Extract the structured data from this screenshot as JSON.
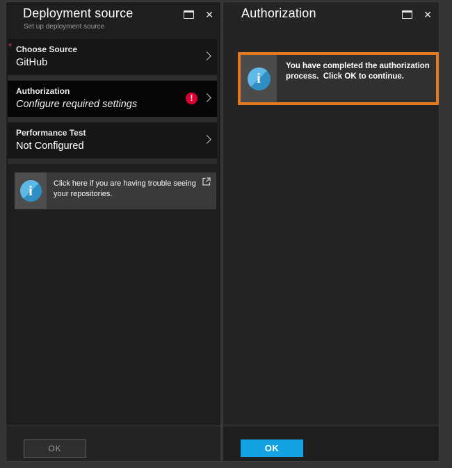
{
  "left_blade": {
    "title": "Deployment source",
    "subtitle": "Set up deployment source",
    "items": [
      {
        "label": "Choose Source",
        "value": "GitHub",
        "required": true,
        "selected": false,
        "error": false
      },
      {
        "label": "Authorization",
        "value": "Configure required settings",
        "required": false,
        "selected": true,
        "error": true
      },
      {
        "label": "Performance Test",
        "value": "Not Configured",
        "required": false,
        "selected": false,
        "error": false
      }
    ],
    "banner": {
      "text": "Click here if you are having trouble seeing your repositories."
    },
    "ok_label": "OK",
    "ok_enabled": false
  },
  "right_blade": {
    "title": "Authorization",
    "info": {
      "text": "You have completed the authorization process.  Click OK to continue."
    },
    "ok_label": "OK",
    "ok_enabled": true
  },
  "icons": {
    "close_glyph": "✕",
    "required_glyph": "*",
    "error_glyph": "!",
    "info_glyph": "i"
  },
  "colors": {
    "accent_blue": "#14a3e2",
    "highlight_orange": "#e2791e",
    "error_red": "#dc0032",
    "info_icon_blue": "#4aa9d8",
    "blade_bg": "#1e1e1e",
    "selected_tile_bg": "#060606"
  }
}
